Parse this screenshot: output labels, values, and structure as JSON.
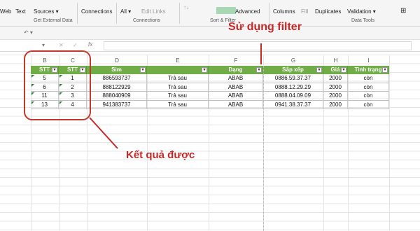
{
  "ribbon": {
    "items": [
      "Web",
      "Text",
      "Sources ▾",
      "Connections",
      "All ▾",
      "Edit Links",
      "Advanced",
      "Columns",
      "Fill",
      "Duplicates",
      "Validation ▾"
    ],
    "groups": [
      "Get External Data",
      "Connections",
      "Sort & Filter",
      "Data Tools"
    ]
  },
  "formula": {
    "fx": "fx",
    "undo": "↶ ▾",
    "name_box": ""
  },
  "columns": [
    "B",
    "C",
    "D",
    "E",
    "F",
    "G",
    "H",
    "I"
  ],
  "table": {
    "headers": [
      "STT",
      "STT",
      "Sim",
      "",
      "Dạng",
      "Sắp xếp",
      "Giá",
      "Tình trạng"
    ],
    "rows": [
      [
        "5",
        "1",
        "886593737",
        "Trả sau",
        "ABAB",
        "0886.59.37.37",
        "2000",
        "còn"
      ],
      [
        "6",
        "2",
        "888122929",
        "Trả sau",
        "ABAB",
        "0888.12.29.29",
        "2000",
        "còn"
      ],
      [
        "11",
        "3",
        "888040909",
        "Trả sau",
        "ABAB",
        "0888.04.09.09",
        "2000",
        "còn"
      ],
      [
        "13",
        "4",
        "941383737",
        "Trả sau",
        "ABAB",
        "0941.38.37.37",
        "2000",
        "còn"
      ]
    ]
  },
  "annotations": {
    "filter_label": "Sử dụng filter",
    "result_label": "Kết quả được"
  },
  "colors": {
    "header_green": "#70ad47",
    "annotation_red": "#c62828"
  }
}
